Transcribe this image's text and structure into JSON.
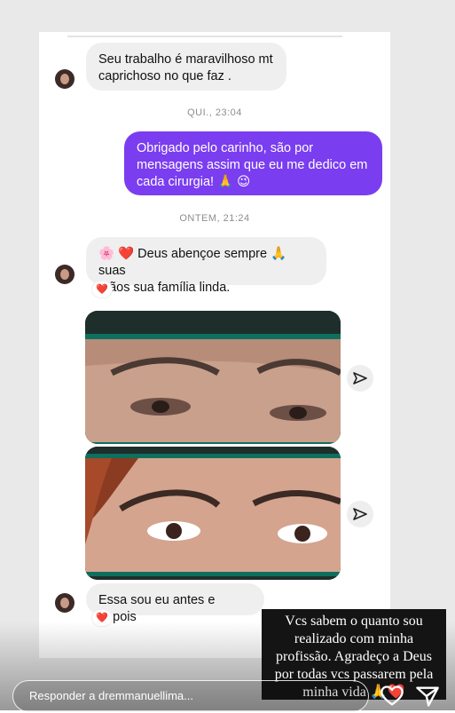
{
  "messages": {
    "msg1": {
      "line1": "Seu trabalho é maravilhoso mt",
      "line2": "caprichoso no que faz ."
    },
    "stamp1": "QUI., 23:04",
    "msg2": {
      "line1": "Obrigado pelo carinho, são por",
      "line2": "mensagens assim que eu me dedico em",
      "line3": "cada cirurgia! 🙏 😉"
    },
    "stamp2": "ONTEM, 21:24",
    "msg3": {
      "line1": "🌸 ❤️ Deus abençoe sempre 🙏 suas",
      "line2": "mãos sua família linda."
    },
    "msg3_reaction": "❤️",
    "msg4": "Essa sou eu antes e depois",
    "msg4_reaction": "❤️"
  },
  "story": {
    "caption_lines": [
      "Vcs sabem o quanto sou",
      "realizado com minha",
      "profissão. Agradeço a Deus",
      "por todas vcs passarem pela",
      "minha vida 🙏❤️"
    ],
    "reply_placeholder": "Responder a dremmanuellima..."
  },
  "icons": {
    "share": "send-icon",
    "like": "heart-icon",
    "send": "paper-plane-icon"
  },
  "colors": {
    "outgoing_bubble": "#7a3df0",
    "incoming_bubble": "#efefef",
    "reaction_heart": "#e0245e"
  }
}
